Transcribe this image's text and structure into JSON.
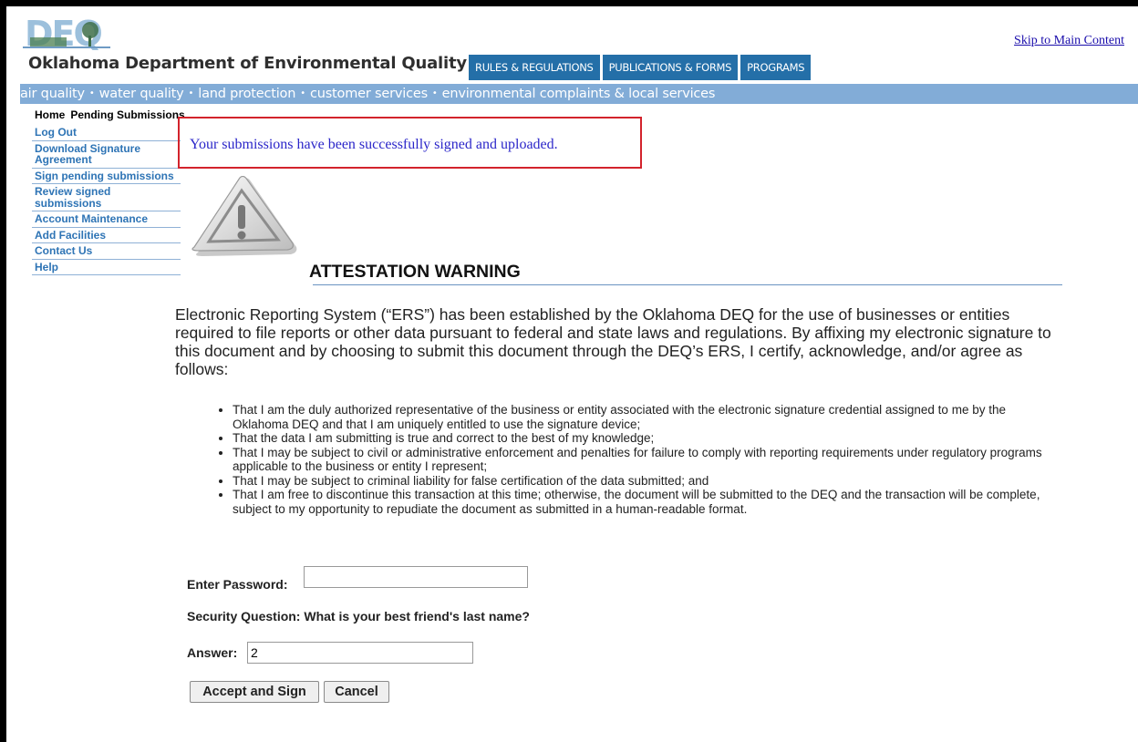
{
  "header": {
    "logo_text": "DEQ",
    "agency_name": "Oklahoma Department of Environmental Quality",
    "skip_link": "Skip to Main Content",
    "tabs": [
      {
        "label": "RULES & REGULATIONS"
      },
      {
        "label": "PUBLICATIONS & FORMS"
      },
      {
        "label": "PROGRAMS"
      }
    ],
    "subnav": [
      {
        "label": "air quality"
      },
      {
        "label": "water quality"
      },
      {
        "label": "land protection"
      },
      {
        "label": "customer services"
      },
      {
        "label": "environmental complaints & local services"
      }
    ],
    "subnav_separator": "•"
  },
  "breadcrumb": {
    "home": "Home",
    "current": "Pending Submissions"
  },
  "sidebar": {
    "items": [
      {
        "label": "Log Out"
      },
      {
        "label": "Download Signature Agreement"
      },
      {
        "label": "Sign pending submissions"
      },
      {
        "label": "Review signed submissions"
      },
      {
        "label": "Account Maintenance"
      },
      {
        "label": "Add Facilities"
      },
      {
        "label": "Contact Us"
      },
      {
        "label": "Help"
      }
    ]
  },
  "main": {
    "success_message": "Your submissions have been successfully signed and uploaded.",
    "warning_icon": "warning-triangle-icon",
    "attestation_title": "ATTESTATION WARNING",
    "intro": "Electronic Reporting System (“ERS”) has been established by the Oklahoma DEQ for the use of businesses or entities required to file reports or other data pursuant to federal and state laws and regulations. By affixing my electronic signature to this document and by choosing to submit this document through the DEQ’s ERS, I certify, acknowledge, and/or agree as follows:",
    "bullets": [
      "That I am the duly authorized representative of the business or entity associated with the electronic signature credential assigned to me by the Oklahoma DEQ and that I am uniquely entitled to use the signature device;",
      "That the data I am submitting is true and correct to the best of my knowledge;",
      "That I may be subject to civil or administrative enforcement and penalties for failure to comply with reporting requirements under regulatory programs applicable to the business or entity I represent;",
      "That I may be subject to criminal liability for false certification of the data submitted; and",
      "That I am free to discontinue this transaction at this time; otherwise, the document will be submitted to the DEQ and the transaction will be complete, subject to my opportunity to repudiate the document as submitted in a human-readable format."
    ]
  },
  "form": {
    "password_label": "Enter Password:",
    "password_value": "",
    "security_question": "Security Question: What is your best friend's last name?",
    "answer_label": "Answer:",
    "answer_value": "2",
    "accept_button": "Accept and Sign",
    "cancel_button": "Cancel"
  },
  "colors": {
    "tab_bg": "#246fa8",
    "subnav_bg": "#82acd7",
    "sidebar_link": "#2e74b5",
    "success_border": "#d3232c",
    "success_text": "#2b26c9"
  }
}
